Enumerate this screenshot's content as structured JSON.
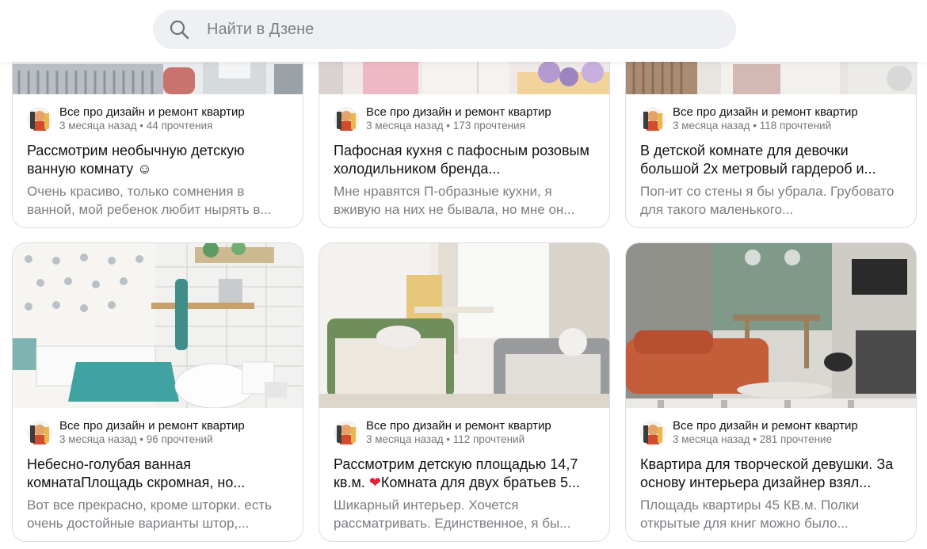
{
  "search": {
    "placeholder": "Найти в Дзене"
  },
  "cards": [
    {
      "channel": "Все про дизайн и ремонт квартир",
      "stats": "3 месяца назад • 44 прочтения",
      "title": "Рассмотрим необычную детскую ванную комнату ☺",
      "snippet": "Очень красиво, только сомнения в ванной, мой ребенок любит нырять в..."
    },
    {
      "channel": "Все про дизайн и ремонт квартир",
      "stats": "3 месяца назад • 173 прочтения",
      "title": "Пафосная кухня с пафосным розовым холодильником бренда...",
      "snippet": "Мне нравятся П-образные кухни, я вживую на них не бывала, но мне он..."
    },
    {
      "channel": "Все про дизайн и ремонт квартир",
      "stats": "3 месяца назад • 118 прочтений",
      "title": "В детской комнате для девочки большой 2х метровый гардероб и...",
      "snippet": "Поп-ит со стены я бы убрала. Грубовато для такого маленького..."
    },
    {
      "channel": "Все про дизайн и ремонт квартир",
      "stats": "3 месяца назад • 96 прочтений",
      "title": "Небесно-голубая ванная комнатаПлощадь скромная, но...",
      "snippet": "Вот все прекрасно, кроме шторки. есть очень достойные варианты штор,..."
    },
    {
      "channel": "Все про дизайн и ремонт квартир",
      "stats": "3 месяца назад • 112 прочтений",
      "title_pre": "Рассмотрим детскую площадью 14,7 кв.м. ",
      "title_heart": "❤",
      "title_post": "Комната для двух братьев 5...",
      "snippet": "Шикарный интерьер. Хочется рассматривать. Единственное, я бы..."
    },
    {
      "channel": "Все про дизайн и ремонт квартир",
      "stats": "3 месяца назад • 281 прочтение",
      "title": "Квартира для творческой девушки. За основу интерьера дизайнер взял...",
      "snippet": "Площадь квартиры 45 КВ.м. Полки открытые для книг можно было..."
    }
  ],
  "icons": {
    "search": "search-icon",
    "avatar": "channel-avatar"
  },
  "colors": {
    "search_bg": "#eef0f3",
    "muted_text": "#7b7d82",
    "border": "#dcdde0"
  }
}
